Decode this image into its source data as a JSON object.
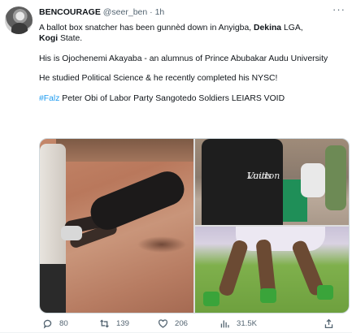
{
  "tweet": {
    "author_name": "BENCOURAGE",
    "author_handle": "@seer_ben",
    "separator": "·",
    "time": "1h",
    "more_label": "···",
    "line1_prefix": "A ballot box snatcher has been gunnèd down in Anyigba, ",
    "line1_bold1": "Dekina",
    "line1_mid": " LGA,",
    "line1_bold2": "Kogi",
    "line1_suffix": " State.",
    "para2": "His is Ojochenemi Akayaba - an alumnus of Prince Abubakar Audu University",
    "para3": "He studied Political Science & he recently completed his NYSC!",
    "hashtag": "#Falz",
    "trend_text": " Peter Obi of Labor Party Sangotedo Soldiers LEIARS VOID"
  },
  "media": {
    "image2_shirt_text_line1": "Louis",
    "image2_shirt_text_line2": "Vuitton"
  },
  "actions": {
    "replies": "80",
    "retweets": "139",
    "likes": "206",
    "views": "31.5K"
  },
  "icons": [
    "reply-icon",
    "retweet-icon",
    "like-icon",
    "views-icon",
    "share-icon"
  ],
  "colors": {
    "link": "#1d9bf0",
    "secondary_text": "#536471",
    "primary_text": "#0f1419"
  }
}
